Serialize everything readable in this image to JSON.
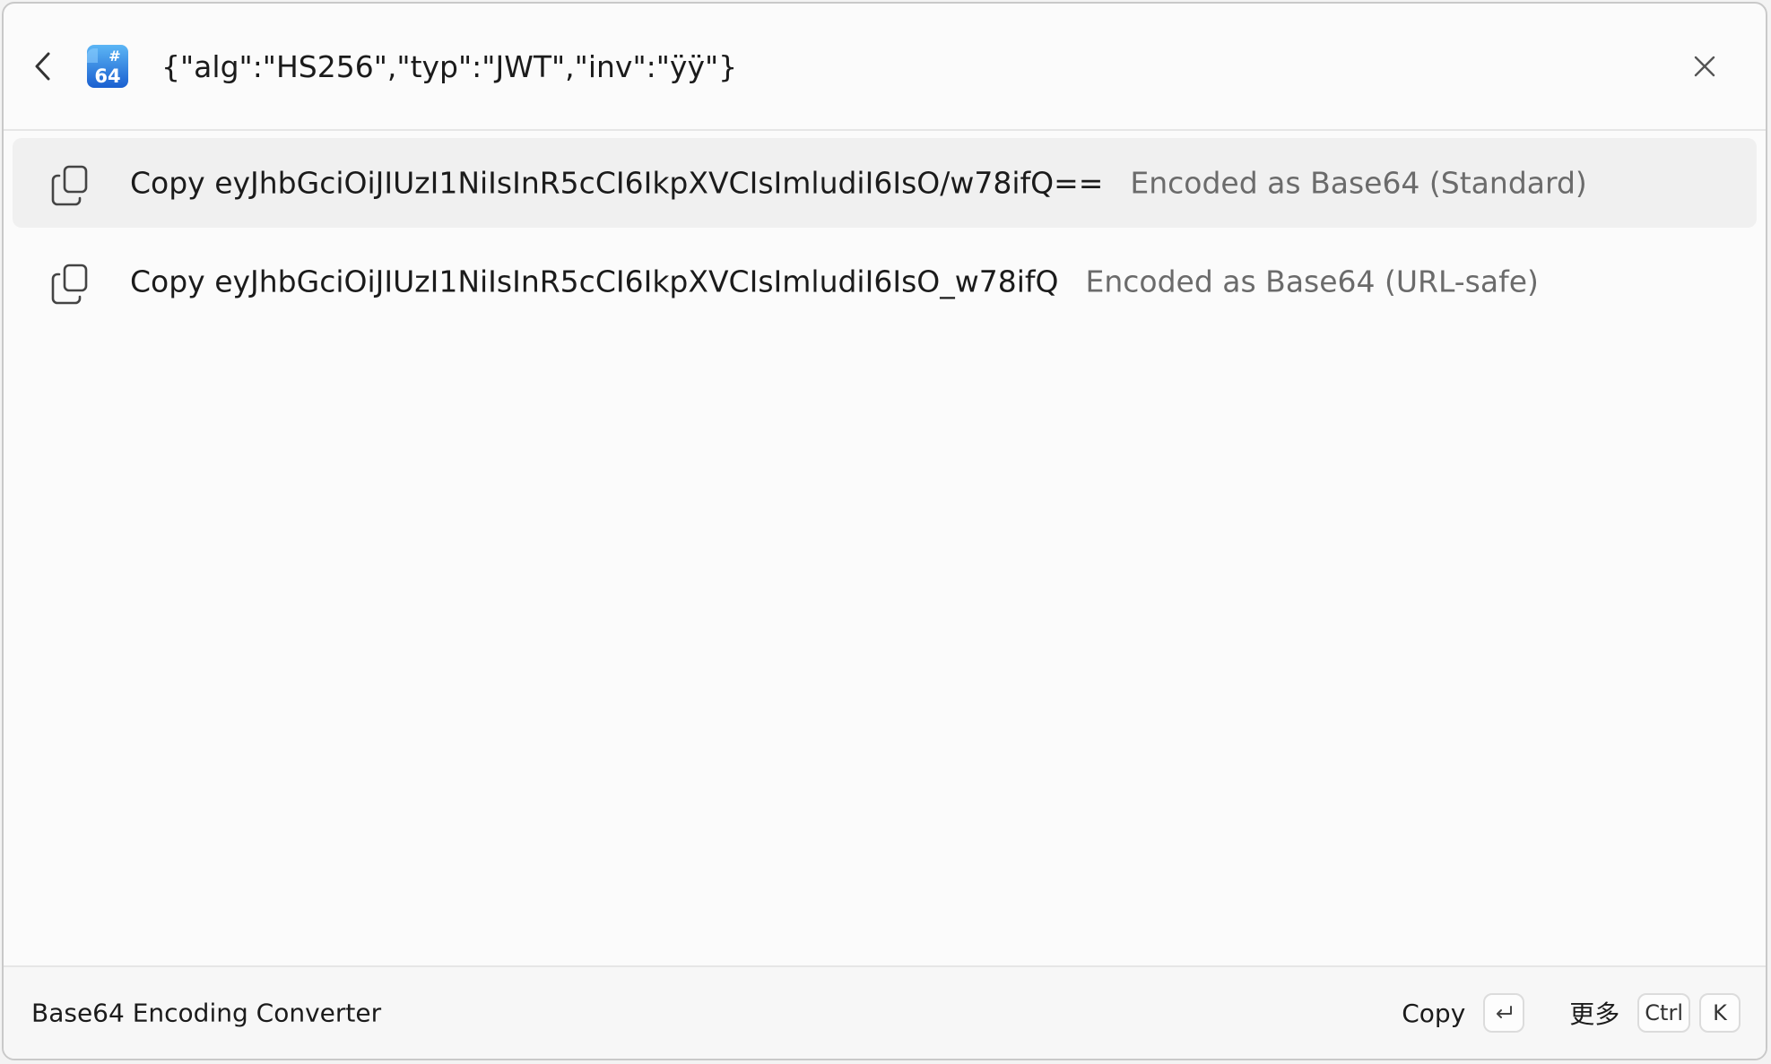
{
  "search": {
    "value": "{\"alg\":\"HS256\",\"typ\":\"JWT\",\"inv\":\"ÿÿ\"}"
  },
  "icons": {
    "back": "chevron-left-icon",
    "app": "base64-app-icon",
    "close": "close-icon",
    "copy": "copy-icon",
    "enter": "enter-key-icon"
  },
  "app_icon": {
    "badge_top": "#",
    "badge_bottom": "64",
    "color_top": "#4fa8f0",
    "color_bottom": "#1a5fd0"
  },
  "results": [
    {
      "title": "Copy eyJhbGciOiJIUzI1NiIsInR5cCI6IkpXVCIsImludiI6IsO/w78ifQ==",
      "subtitle": "Encoded as Base64 (Standard)",
      "selected": true
    },
    {
      "title": "Copy eyJhbGciOiJIUzI1NiIsInR5cCI6IkpXVCIsImludiI6IsO_w78ifQ",
      "subtitle": "Encoded as Base64 (URL-safe)",
      "selected": false
    }
  ],
  "footer": {
    "title": "Base64 Encoding Converter",
    "primary_action": "Copy",
    "more_action": "更多",
    "keys": {
      "ctrl": "Ctrl",
      "k": "K"
    }
  }
}
